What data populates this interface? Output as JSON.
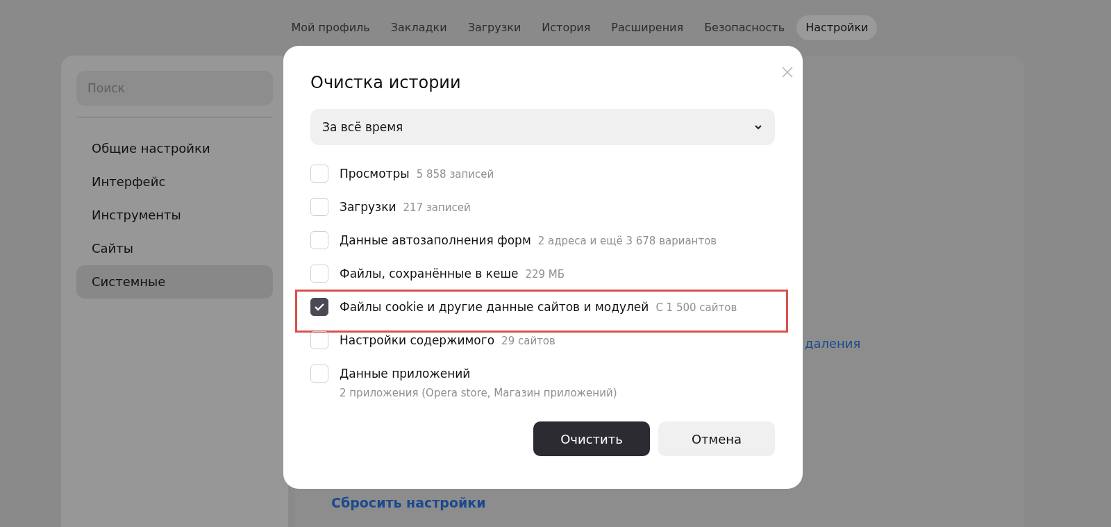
{
  "nav": [
    {
      "label": "Мой профиль",
      "selected": false
    },
    {
      "label": "Закладки",
      "selected": false
    },
    {
      "label": "Загрузки",
      "selected": false
    },
    {
      "label": "История",
      "selected": false
    },
    {
      "label": "Расширения",
      "selected": false
    },
    {
      "label": "Безопасность",
      "selected": false
    },
    {
      "label": "Настройки",
      "selected": true
    }
  ],
  "sidebar": {
    "search": {
      "placeholder": "Поиск"
    },
    "items": [
      {
        "label": "Общие настройки",
        "selected": false
      },
      {
        "label": "Интерфейс",
        "selected": false
      },
      {
        "label": "Инструменты",
        "selected": false
      },
      {
        "label": "Сайты",
        "selected": false
      },
      {
        "label": "Системные",
        "selected": true
      }
    ]
  },
  "main": {
    "links": [
      {
        "kind": "partial",
        "text": "даления"
      },
      {
        "kind": "bold",
        "text": "Сбросить настройки"
      }
    ]
  },
  "dialog": {
    "title": "Очистка истории",
    "period": "За всё время",
    "items": [
      {
        "kind": "inline",
        "label": "Просмотры",
        "note": "5 858 записей",
        "checked": false,
        "highlighted": false
      },
      {
        "kind": "inline",
        "label": "Загрузки",
        "note": "217 записей",
        "checked": false,
        "highlighted": false
      },
      {
        "kind": "inline",
        "label": "Данные автозаполнения форм",
        "note": "2 адреса и ещё 3 678 вариантов",
        "checked": false,
        "highlighted": false
      },
      {
        "kind": "inline",
        "label": "Файлы, сохранённые в кеше",
        "note": "229 МБ",
        "checked": false,
        "highlighted": false
      },
      {
        "kind": "inline",
        "label": "Файлы cookie и другие данные сайтов и модулей",
        "note": "С 1 500 сайтов",
        "checked": true,
        "highlighted": true
      },
      {
        "kind": "inline",
        "label": "Настройки содержимого",
        "note": "29 сайтов",
        "checked": false,
        "highlighted": false
      },
      {
        "kind": "stacked",
        "label": "Данные приложений",
        "note": "2 приложения (Opera store, Магазин приложений)",
        "checked": false,
        "highlighted": false
      }
    ],
    "buttons": [
      {
        "kind": "primary",
        "label": "Очистить"
      },
      {
        "kind": "secondary",
        "label": "Отмена"
      }
    ]
  }
}
